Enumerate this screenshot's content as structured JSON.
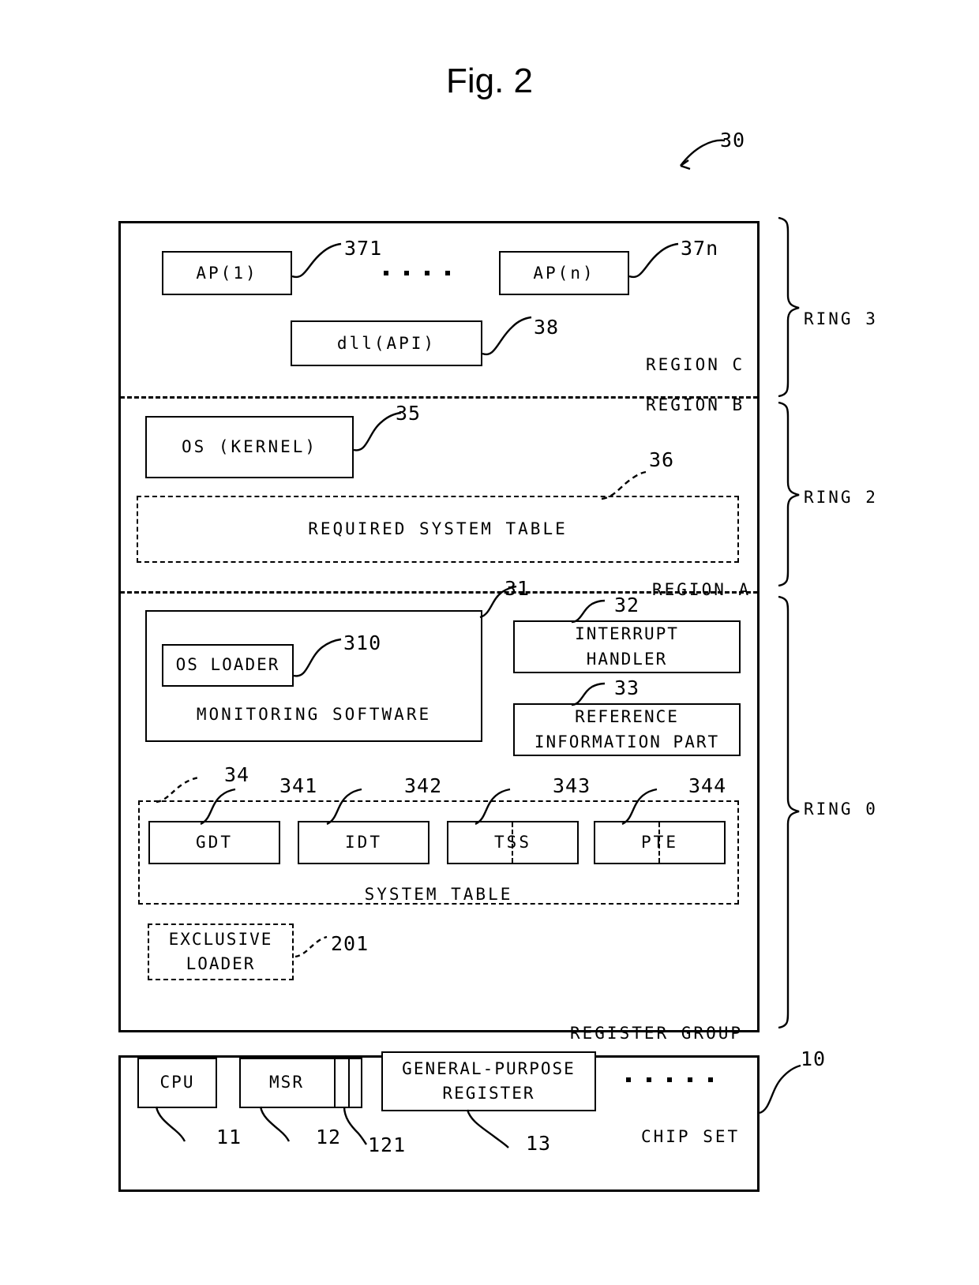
{
  "figure": {
    "title": "Fig. 2",
    "top_ref": "30"
  },
  "memory_map": {
    "ring3": {
      "ring_label": "RING 3",
      "region_label": "REGION C",
      "ap_first": {
        "label": "AP(1)",
        "ref": "371"
      },
      "ap_last": {
        "label": "AP(n)",
        "ref": "37n"
      },
      "ellipsis_dots": 4,
      "dll": {
        "label": "dll(API)",
        "ref": "38"
      }
    },
    "ring2": {
      "ring_label": "RING 2",
      "region_label": "REGION B",
      "os_kernel": {
        "label": "OS (KERNEL)",
        "ref": "35"
      },
      "required_system_table": {
        "label": "REQUIRED SYSTEM TABLE",
        "ref": "36"
      }
    },
    "ring0": {
      "ring_label": "RING 0",
      "region_label": "REGION A",
      "monitoring_software": {
        "label": "MONITORING SOFTWARE",
        "ref": "31"
      },
      "os_loader": {
        "label": "OS LOADER",
        "ref": "310"
      },
      "interrupt_handler": {
        "label_line1": "INTERRUPT",
        "label_line2": "HANDLER",
        "ref": "32"
      },
      "reference_information_part": {
        "label_line1": "REFERENCE",
        "label_line2": "INFORMATION PART",
        "ref": "33"
      },
      "system_table": {
        "label": "SYSTEM TABLE",
        "ref": "34",
        "entries": [
          {
            "label": "GDT",
            "ref": "341",
            "divider": false
          },
          {
            "label": "IDT",
            "ref": "342",
            "divider": false
          },
          {
            "label": "TSS",
            "ref": "343",
            "divider": true
          },
          {
            "label": "PTE",
            "ref": "344",
            "divider": true
          }
        ]
      },
      "exclusive_loader": {
        "label_line1": "EXCLUSIVE",
        "label_line2": "LOADER",
        "ref": "201"
      }
    }
  },
  "chip_set": {
    "title": "CHIP SET",
    "register_group_label": "REGISTER GROUP",
    "ref": "10",
    "cpu": {
      "label": "CPU",
      "ref": "11"
    },
    "msr": {
      "label": "MSR",
      "ref": "12",
      "sub_cell_ref": "121"
    },
    "general_purpose_register": {
      "label_line1": "GENERAL-PURPOSE",
      "label_line2": "REGISTER",
      "ref": "13"
    },
    "ellipsis_dots": 5
  }
}
